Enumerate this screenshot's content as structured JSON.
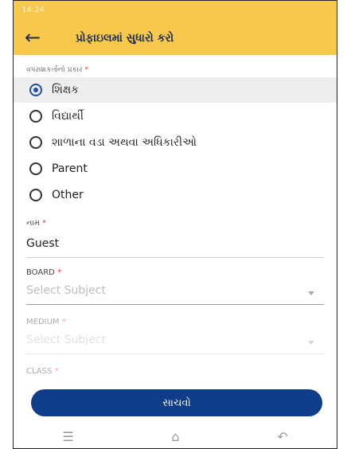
{
  "status_bar": {
    "time": "14:24"
  },
  "header": {
    "title": "પ્રોફાઇલમાં સુધારો કરો"
  },
  "user_type": {
    "label": "વપરાશકર્તાનો પ્રકાર",
    "required_mark": "*",
    "options": [
      "શિક્ષક",
      "વિદ્યાર્થી",
      "શાળાના વડા અથવા અધિકારીઓ",
      "Parent",
      "Other"
    ],
    "selected": "શિક્ષક"
  },
  "name": {
    "label": "નામ",
    "required_mark": "*",
    "value": "Guest"
  },
  "board": {
    "label": "BOARD",
    "required_mark": "*",
    "placeholder": "Select Subject"
  },
  "medium": {
    "label": "MEDIUM",
    "required_mark": "*",
    "placeholder": "Select Subject"
  },
  "class_field": {
    "label": "CLASS",
    "required_mark": "*"
  },
  "save": {
    "label": "સાચવો"
  },
  "colors": {
    "header_bg": "#f7c84a",
    "primary": "#0f3d8a",
    "required": "#e53935"
  },
  "nav_icons": [
    "menu-icon",
    "home-icon",
    "back-icon"
  ]
}
